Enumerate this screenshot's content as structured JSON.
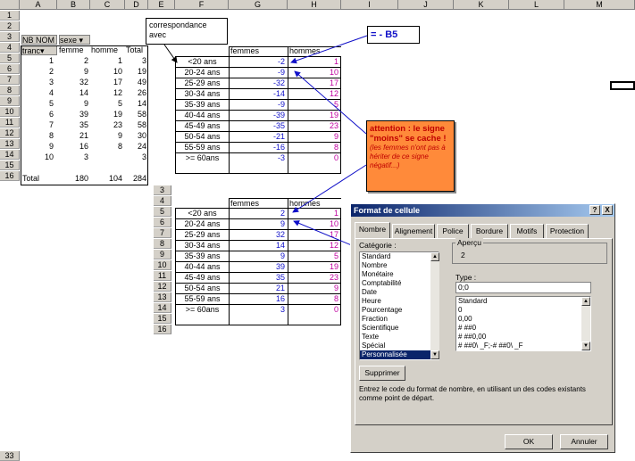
{
  "col_headers": [
    "A",
    "B",
    "C",
    "D",
    "E",
    "F",
    "G",
    "H",
    "I",
    "J",
    "K",
    "L",
    "M"
  ],
  "row_headers_main": [
    "1",
    "2",
    "3",
    "4",
    "5",
    "6",
    "7",
    "8",
    "9",
    "10",
    "11",
    "12",
    "13",
    "14",
    "15",
    "16"
  ],
  "row_headers_far": [
    "33"
  ],
  "pivot": {
    "field_row3_a": "NB NOM",
    "field_row3_b": "sexe",
    "hdr_tranche": "tranc",
    "hdr_femme": "femme",
    "hdr_homme": "homme",
    "hdr_total": "Total",
    "rows": [
      [
        "1",
        "1",
        "2",
        "1",
        "3"
      ],
      [
        "2",
        "2",
        "9",
        "10",
        "19"
      ],
      [
        "3",
        "3",
        "32",
        "17",
        "49"
      ],
      [
        "4",
        "4",
        "14",
        "12",
        "26"
      ],
      [
        "5",
        "5",
        "9",
        "5",
        "14"
      ],
      [
        "6",
        "6",
        "39",
        "19",
        "58"
      ],
      [
        "7",
        "7",
        "35",
        "23",
        "58"
      ],
      [
        "8",
        "8",
        "21",
        "9",
        "30"
      ],
      [
        "9",
        "9",
        "16",
        "8",
        "24"
      ],
      [
        "10",
        "10",
        "3",
        "",
        "3"
      ]
    ],
    "total_label": "Total",
    "total_femme": "180",
    "total_homme": "104",
    "total_all": "284"
  },
  "table_top": {
    "col_femmes": "femmes",
    "col_hommes": "hommes",
    "rows": [
      [
        "<20 ans",
        "-2",
        "1"
      ],
      [
        "20-24 ans",
        "-9",
        "10"
      ],
      [
        "25-29 ans",
        "-32",
        "17"
      ],
      [
        "30-34 ans",
        "-14",
        "12"
      ],
      [
        "35-39 ans",
        "-9",
        "5"
      ],
      [
        "40-44 ans",
        "-39",
        "19"
      ],
      [
        "45-49 ans",
        "-35",
        "23"
      ],
      [
        "50-54 ans",
        "-21",
        "9"
      ],
      [
        "55-59 ans",
        "-16",
        "8"
      ],
      [
        ">= 60ans",
        "-3",
        "0"
      ]
    ]
  },
  "table_bottom": {
    "row_headers": [
      "3",
      "4",
      "5",
      "6",
      "7",
      "8",
      "9",
      "10",
      "11",
      "12",
      "13",
      "14",
      "15",
      "16"
    ],
    "col_femmes": "femmes",
    "col_hommes": "hommes",
    "rows": [
      [
        "<20 ans",
        "2",
        "1"
      ],
      [
        "20-24 ans",
        "9",
        "10"
      ],
      [
        "25-29 ans",
        "32",
        "17"
      ],
      [
        "30-34 ans",
        "14",
        "12"
      ],
      [
        "35-39 ans",
        "9",
        "5"
      ],
      [
        "40-44 ans",
        "39",
        "19"
      ],
      [
        "45-49 ans",
        "35",
        "23"
      ],
      [
        "50-54 ans",
        "21",
        "9"
      ],
      [
        "55-59 ans",
        "16",
        "8"
      ],
      [
        ">= 60ans",
        "3",
        "0"
      ]
    ]
  },
  "callouts": {
    "correspondance_line1": "correspondance",
    "correspondance_line2": "avec",
    "formula": "= - B5",
    "warn_title": "attention : le signe \"moins\" se cache !",
    "warn_body": "(les femmes n'ont pas à hériter de ce signe négatif...)"
  },
  "dialog": {
    "title": "Format de cellule",
    "help_btn": "?",
    "close_btn": "X",
    "tabs": [
      "Nombre",
      "Alignement",
      "Police",
      "Bordure",
      "Motifs",
      "Protection"
    ],
    "categorie_label": "Catégorie :",
    "categories": [
      "Standard",
      "Nombre",
      "Monétaire",
      "Comptabilité",
      "Date",
      "Heure",
      "Pourcentage",
      "Fraction",
      "Scientifique",
      "Texte",
      "Spécial",
      "Personnalisée"
    ],
    "apercu_label": "Aperçu",
    "apercu_value": "2",
    "type_label": "Type :",
    "type_value": "0;0",
    "type_list": [
      "Standard",
      "0",
      "0,00",
      "# ##0",
      "# ##0,00",
      "# ##0\\ _F;-# ##0\\ _F"
    ],
    "supprimer": "Supprimer",
    "description": "Entrez le code du format de nombre, en utilisant un des codes existants comme point de départ.",
    "ok": "OK",
    "annuler": "Annuler"
  },
  "colors": {
    "accent_blue": "#1010c8",
    "magenta": "#c000a0",
    "warn_bg": "#ff8a3a",
    "title_bar": "#0a246a"
  }
}
